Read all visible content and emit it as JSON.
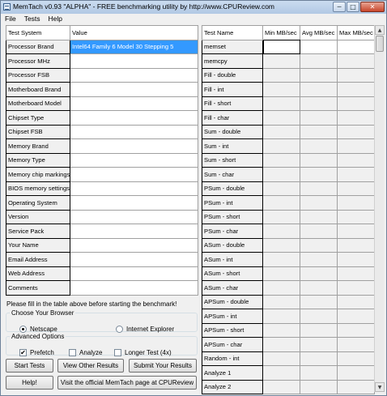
{
  "window": {
    "title": "MemTach v0.93 \"ALPHA\" - FREE benchmarking utility by http://www.CPUReview.com",
    "minimize": "─",
    "maximize": "□",
    "close": "✕"
  },
  "menu": [
    "File",
    "Tests",
    "Help"
  ],
  "system_table": {
    "headers": [
      "Test System",
      "Value"
    ],
    "rows": [
      {
        "label": "Processor Brand",
        "value": "Intel64 Family 6 Model 30 Stepping 5"
      },
      {
        "label": "Processor MHz",
        "value": ""
      },
      {
        "label": "Processor FSB",
        "value": ""
      },
      {
        "label": "Motherboard Brand",
        "value": ""
      },
      {
        "label": "Motherboard Model",
        "value": ""
      },
      {
        "label": "Chipset Type",
        "value": ""
      },
      {
        "label": "Chipset FSB",
        "value": ""
      },
      {
        "label": "Memory Brand",
        "value": ""
      },
      {
        "label": "Memory Type",
        "value": ""
      },
      {
        "label": "Memory chip markings",
        "value": ""
      },
      {
        "label": "BIOS memory settings",
        "value": ""
      },
      {
        "label": "Operating System",
        "value": ""
      },
      {
        "label": "Version",
        "value": ""
      },
      {
        "label": "Service Pack",
        "value": ""
      },
      {
        "label": "Your Name",
        "value": ""
      },
      {
        "label": "Email Address",
        "value": ""
      },
      {
        "label": "Web Address",
        "value": ""
      },
      {
        "label": "Comments",
        "value": ""
      }
    ]
  },
  "results_table": {
    "headers": [
      "Test Name",
      "Min MB/sec",
      "Avg MB/sec",
      "Max MB/sec"
    ],
    "rows": [
      "memset",
      "memcpy",
      "Fill - double",
      "Fill - int",
      "Fill - short",
      "Fill - char",
      "Sum - double",
      "Sum - int",
      "Sum - short",
      "Sum - char",
      "PSum - double",
      "PSum - int",
      "PSum - short",
      "PSum - char",
      "ASum - double",
      "ASum - int",
      "ASum - short",
      "ASum - char",
      "APSum - double",
      "APSum - int",
      "APSum - short",
      "APSum - char",
      "Random - int",
      "Analyze 1",
      "Analyze 2"
    ]
  },
  "notice": "Please fill in the table above before  starting the benchmark!",
  "browser_group": {
    "legend": "Choose Your Browser",
    "options": [
      {
        "label": "Netscape",
        "selected": true
      },
      {
        "label": "Internet Explorer",
        "selected": false
      }
    ]
  },
  "advanced_group": {
    "legend": "Advanced Options",
    "options": [
      {
        "label": "Prefetch",
        "checked": true
      },
      {
        "label": "Analyze",
        "checked": false
      },
      {
        "label": "Longer Test (4x)",
        "checked": false
      }
    ]
  },
  "buttons": {
    "start_tests": "Start Tests",
    "view_other_results": "View Other Results",
    "submit_results": "Submit Your Results",
    "help": "Help!",
    "visit_page": "Visit the official MemTach page at CPUReview"
  },
  "scrollbar": {
    "up": "▲",
    "down": "▼"
  },
  "checkmark": "✔",
  "colors": {
    "selection": "#3399ff",
    "titlebar": "#b9cde6"
  }
}
